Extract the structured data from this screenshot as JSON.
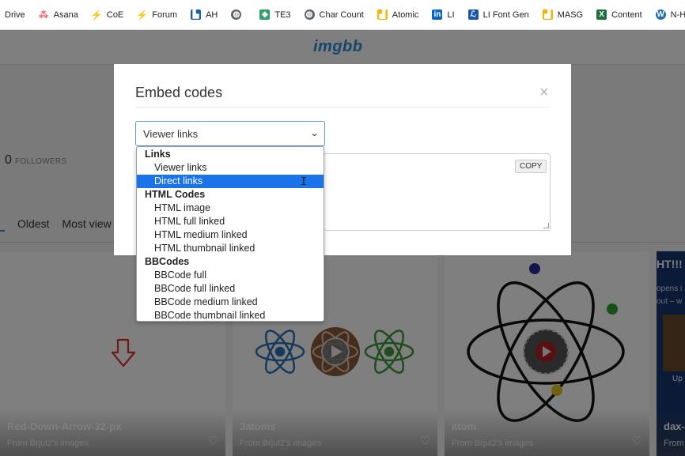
{
  "bookmarks": [
    {
      "label": "Drive",
      "icon": "drive-icon",
      "color": "#1fa463"
    },
    {
      "label": "Asana",
      "icon": "asana-icon",
      "color": "#f06a6a"
    },
    {
      "label": "CoE",
      "icon": "coe-icon",
      "color": "#2a7fd4"
    },
    {
      "label": "Forum",
      "icon": "forum-icon",
      "color": "#2a7fd4"
    },
    {
      "label": "AH",
      "icon": "ah-icon",
      "color": "#1b5fa8"
    },
    {
      "label": "",
      "icon": "globe-icon",
      "color": "#5f6368"
    },
    {
      "label": "TE3",
      "icon": "te3-icon",
      "color": "#2e9e6b"
    },
    {
      "label": "Char Count",
      "icon": "globe-icon",
      "color": "#5f6368"
    },
    {
      "label": "Atomic",
      "icon": "atomic-icon",
      "color": "#f4b400"
    },
    {
      "label": "LI",
      "icon": "linkedin-icon",
      "color": "#0a66c2"
    },
    {
      "label": "LI Font Gen",
      "icon": "li-font-gen-icon",
      "color": "#1a56b0"
    },
    {
      "label": "MASG",
      "icon": "masg-icon",
      "color": "#f4b400"
    },
    {
      "label": "Content",
      "icon": "excel-icon",
      "color": "#1d6f42"
    },
    {
      "label": "N-Hub",
      "icon": "wordpress-icon",
      "color": "#2271b1"
    }
  ],
  "site": {
    "logo": "imgbb"
  },
  "profile": {
    "followers_count": "0",
    "followers_label": "FOLLOWERS"
  },
  "sort": {
    "oldest": "Oldest",
    "most_viewed": "Most view"
  },
  "cards": [
    {
      "title": "Red-Down-Arrow-32-px",
      "subtitle": "From Brjul2's images"
    },
    {
      "title": "3atoms",
      "subtitle": "From Brjul2's images"
    },
    {
      "title": "atom",
      "subtitle": "From Brjul2's images"
    },
    {
      "title": "dax-",
      "subtitle": "From",
      "promo_head": "HT!!!",
      "promo_line1": "opens i",
      "promo_line2": "out – w",
      "promo_up": "Up"
    }
  ],
  "modal": {
    "title": "Embed codes",
    "close": "×",
    "select_value": "Viewer links",
    "copy_label": "COPY"
  },
  "dropdown": {
    "groups": [
      {
        "label": "Links",
        "options": [
          "Viewer links",
          "Direct links"
        ]
      },
      {
        "label": "HTML Codes",
        "options": [
          "HTML image",
          "HTML full linked",
          "HTML medium linked",
          "HTML thumbnail linked"
        ]
      },
      {
        "label": "BBCodes",
        "options": [
          "BBCode full",
          "BBCode full linked",
          "BBCode medium linked",
          "BBCode thumbnail linked"
        ]
      }
    ],
    "highlighted": "Direct links"
  },
  "colors": {
    "accent": "#2a8fd3",
    "highlight": "#1a73e8",
    "arrow_red": "#d9392f"
  }
}
